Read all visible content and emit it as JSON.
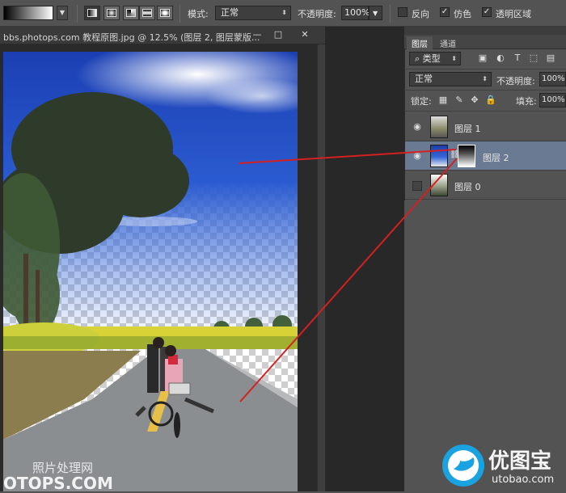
{
  "options_bar": {
    "mode_label": "模式:",
    "mode_value": "正常",
    "opacity_label": "不透明度:",
    "opacity_value": "100%",
    "reverse_label": "反向",
    "dither_label": "仿色",
    "transparency_label": "透明区域",
    "dither_checked": "✓",
    "transparency_checked": "✓"
  },
  "document": {
    "title": "bbs.photops.com 教程原图.jpg @ 12.5% (图层 2, 图层蒙版...",
    "minimize": "—",
    "maximize": "□",
    "close": "✕"
  },
  "panel": {
    "tabs": [
      {
        "label": "图层"
      },
      {
        "label": "通道"
      }
    ],
    "filter_label": "类型",
    "blend_mode": "正常",
    "opacity_label": "不透明度:",
    "opacity_value": "100%",
    "lock_label": "锁定:",
    "fill_label": "填充:",
    "fill_value": "100%",
    "layers": [
      {
        "name": "图层 1",
        "visible": true
      },
      {
        "name": "图层 2",
        "visible": true,
        "selected": true
      },
      {
        "name": "图层 0",
        "visible": false
      }
    ]
  },
  "watermarks": {
    "left_cn": "照片处理网",
    "left_en": "OTOPS.COM",
    "right_cn": "优图宝",
    "right_en": "utobao.com"
  },
  "colors": {
    "selection": "#6a7a93",
    "annotation_line": "#d42020",
    "sky": "#2a55c6"
  }
}
